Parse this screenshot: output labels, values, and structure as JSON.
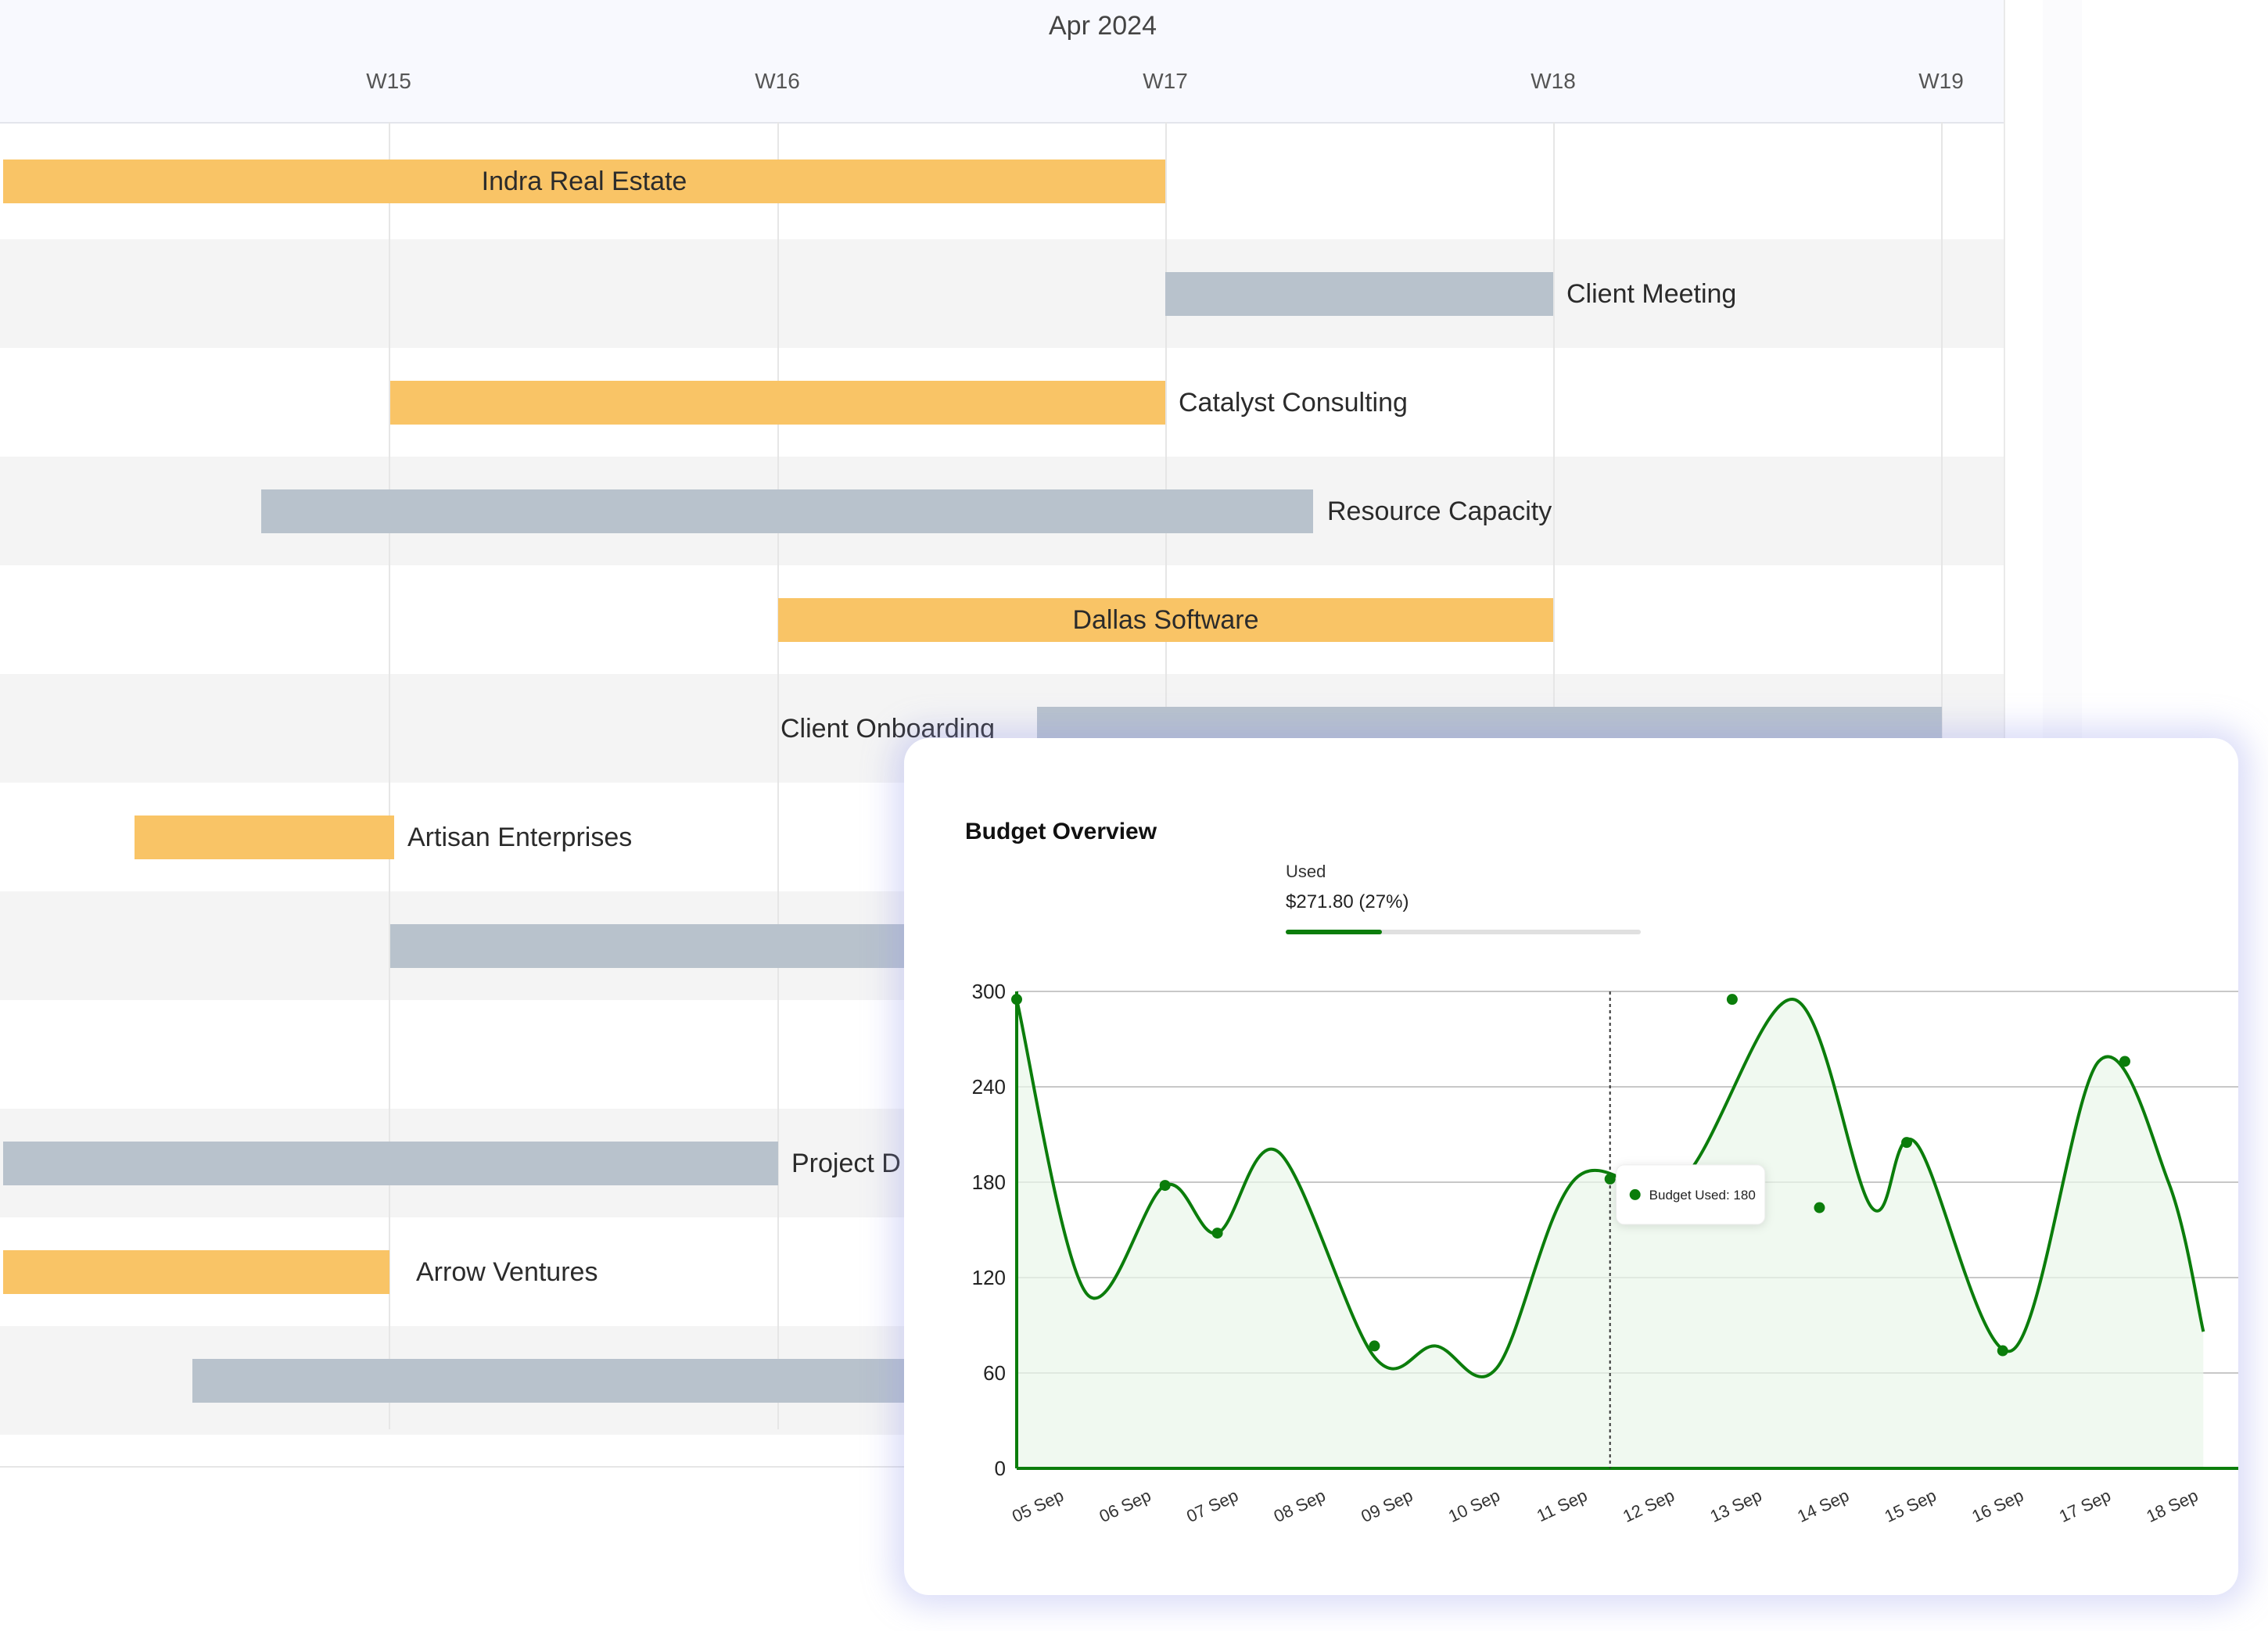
{
  "gantt": {
    "month": "Apr 2024",
    "weeks": [
      "W15",
      "W16",
      "W17",
      "W18",
      "W19"
    ],
    "rows": [
      {
        "label": "Indra Real Estate",
        "kind": "task"
      },
      {
        "label": "Client Meeting",
        "kind": "milestone"
      },
      {
        "label": "Catalyst Consulting",
        "kind": "task"
      },
      {
        "label": "Resource Capacity",
        "kind": "milestone"
      },
      {
        "label": "Dallas Software",
        "kind": "task"
      },
      {
        "label": "Client Onboarding",
        "kind": "milestone"
      },
      {
        "label": "Artisan Enterprises",
        "kind": "task"
      },
      {
        "label": "",
        "kind": "milestone"
      },
      {
        "label": "",
        "kind": "task"
      },
      {
        "label": "Project D",
        "kind": "milestone"
      },
      {
        "label": "Arrow Ventures",
        "kind": "task"
      },
      {
        "label": "",
        "kind": "milestone"
      }
    ]
  },
  "budget": {
    "title": "Budget Overview",
    "used_label": "Used",
    "used_value": "$271.80 (27%)",
    "used_fraction": 0.27,
    "tooltip": "Budget Used: 180"
  },
  "chart_data": {
    "type": "area",
    "title": "Budget Overview",
    "xlabel": "",
    "ylabel": "",
    "ylim": [
      0,
      300
    ],
    "yticks": [
      0,
      60,
      120,
      180,
      240,
      300
    ],
    "categories": [
      "05 Sep",
      "06 Sep",
      "07 Sep",
      "08 Sep",
      "09 Sep",
      "10 Sep",
      "11 Sep",
      "12 Sep",
      "13 Sep",
      "14 Sep",
      "15 Sep",
      "16 Sep",
      "17 Sep",
      "18 Sep"
    ],
    "series": [
      {
        "x": [
          4.5,
          5.3,
          6.2,
          6.8,
          7.5,
          8.6,
          9.3,
          10.0,
          10.9,
          12.1,
          13.4,
          14.3,
          14.8,
          15.9,
          16.9,
          17.7,
          18.1
        ],
        "y": [
          295,
          110,
          178,
          148,
          199,
          70,
          77,
          63,
          182,
          180,
          295,
          164,
          205,
          74,
          256,
          180,
          86
        ]
      }
    ],
    "marked_points": [
      {
        "x": 4.5,
        "y": 295
      },
      {
        "x": 6.2,
        "y": 178
      },
      {
        "x": 6.8,
        "y": 148
      },
      {
        "x": 8.6,
        "y": 77
      },
      {
        "x": 11.3,
        "y": 182
      },
      {
        "x": 12.7,
        "y": 295
      },
      {
        "x": 13.7,
        "y": 164
      },
      {
        "x": 14.7,
        "y": 205
      },
      {
        "x": 15.8,
        "y": 74
      },
      {
        "x": 17.2,
        "y": 256
      }
    ],
    "hover_x": 11.3,
    "grid": true,
    "color": "#0b7d0b"
  }
}
